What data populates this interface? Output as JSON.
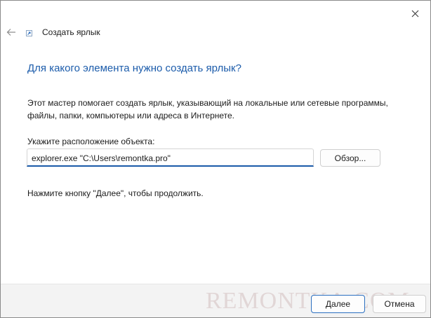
{
  "window": {
    "close_icon": "close-icon",
    "back_icon": "back-arrow-icon"
  },
  "wizard": {
    "title": "Создать ярлык",
    "title_icon": "shortcut-icon",
    "question": "Для какого элемента нужно создать ярлык?",
    "description": "Этот мастер помогает создать ярлык, указывающий на локальные или сетевые программы, файлы, папки, компьютеры или адреса в Интернете.",
    "location_label": "Укажите расположение объекта:",
    "location_value": "explorer.exe \"C:\\Users\\remontka.pro\"",
    "browse_label": "Обзор...",
    "hint": "Нажмите кнопку \"Далее\", чтобы продолжить."
  },
  "footer": {
    "next_label": "Далее",
    "cancel_label": "Отмена"
  },
  "watermark": {
    "text": "REMONTKA.COM"
  },
  "colors": {
    "accent": "#1a5aa8",
    "question_text": "#1c5cab",
    "footer_bg": "#f3f3f3"
  }
}
